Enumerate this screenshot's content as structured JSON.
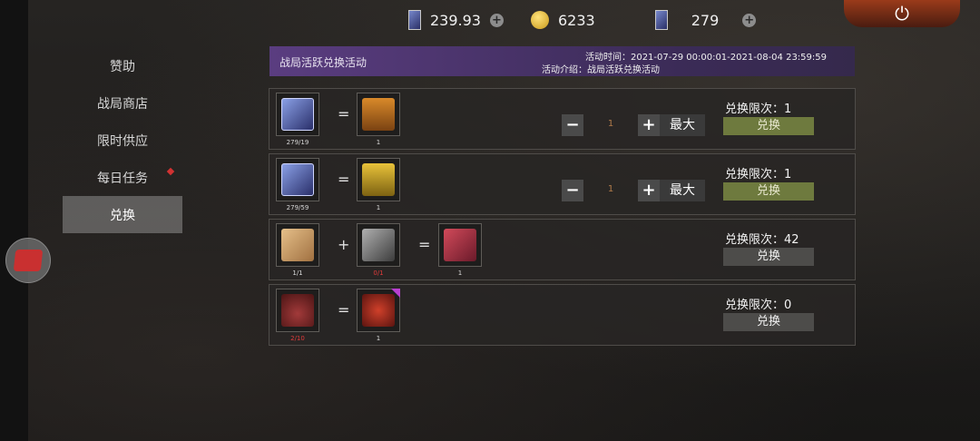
{
  "topbar": {
    "resources": [
      {
        "icon": "card-icon",
        "value": "239.93",
        "has_plus": true
      },
      {
        "icon": "gold-coin-icon",
        "value": "6233",
        "has_plus": false
      },
      {
        "icon": "blue-card-icon",
        "value": "279",
        "has_plus": true
      }
    ],
    "plus_symbol": "+",
    "power_symbol": "⏻"
  },
  "sidebar": {
    "items": [
      {
        "label": "赞助"
      },
      {
        "label": "战局商店"
      },
      {
        "label": "限时供应"
      },
      {
        "label": "每日任务",
        "badge": true
      },
      {
        "label": "兑换",
        "active": true
      }
    ]
  },
  "event": {
    "title": "战局活跃兑换活动",
    "time": "活动时间：2021-07-29 00:00:01-2021-08-04 23:59:59",
    "intro": "活动介绍：战局活跃兑换活动"
  },
  "exchange": {
    "limit_prefix": "兑换限次：",
    "button_label": "兑换",
    "max_label": "最大",
    "minus_symbol": "−",
    "plus_symbol": "+",
    "rows": [
      {
        "inputs": [
          {
            "name": "blue-card-item",
            "count": "279/19",
            "count_red": false
          }
        ],
        "operators": [
          "="
        ],
        "output": {
          "name": "orange-crate-item",
          "count": "1"
        },
        "quantity": "1",
        "limit": "1",
        "button_active": true
      },
      {
        "inputs": [
          {
            "name": "blue-card-item",
            "count": "279/59",
            "count_red": false
          }
        ],
        "operators": [
          "="
        ],
        "output": {
          "name": "yellow-crate-item",
          "count": "1"
        },
        "quantity": "1",
        "limit": "1",
        "button_active": true
      },
      {
        "inputs": [
          {
            "name": "envelope-item",
            "count": "1/1",
            "count_red": false
          },
          {
            "name": "metal-box-item",
            "count": "0/1",
            "count_red": true
          }
        ],
        "operators": [
          "+",
          "="
        ],
        "output": {
          "name": "red-crate-item",
          "count": "1"
        },
        "limit": "42",
        "button_active": false
      },
      {
        "inputs": [
          {
            "name": "birthday-cake-item",
            "count": "2/10",
            "count_red": true
          }
        ],
        "operators": [
          "="
        ],
        "output": {
          "name": "red-wings-item",
          "count": "1"
        },
        "limit": "0",
        "button_active": false
      }
    ]
  }
}
